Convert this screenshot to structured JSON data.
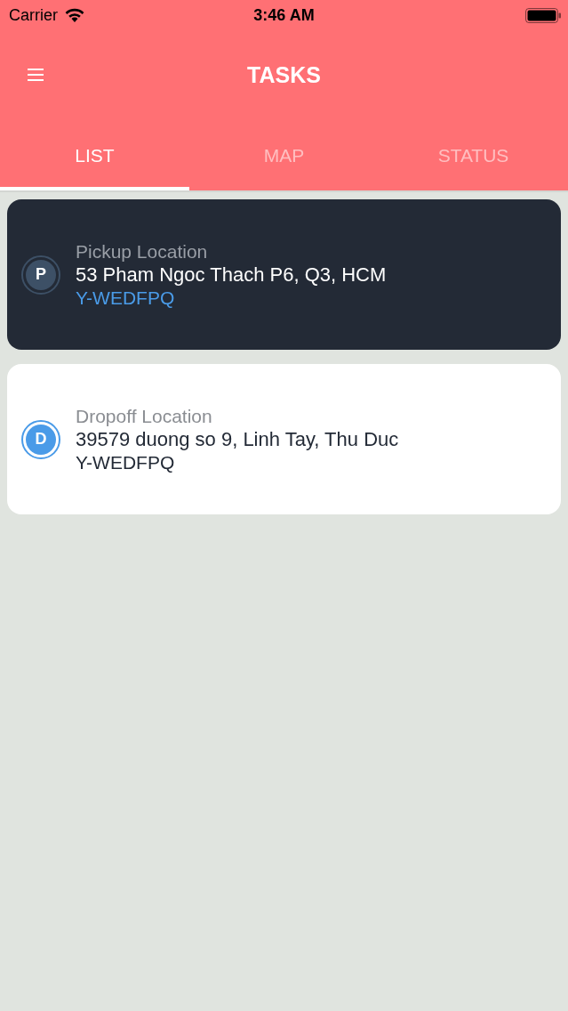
{
  "status_bar": {
    "carrier": "Carrier",
    "time": "3:46 AM"
  },
  "header": {
    "title": "TASKS"
  },
  "tabs": [
    {
      "label": "LIST",
      "selected": true
    },
    {
      "label": "MAP",
      "selected": false
    },
    {
      "label": "STATUS",
      "selected": false
    }
  ],
  "tasks": [
    {
      "selected": true,
      "marker": {
        "letter": "P",
        "color": "#3d5066"
      },
      "label": "Pickup Location",
      "address": "53 Pham Ngoc Thach P6, Q3, HCM",
      "code": "Y-WEDFPQ"
    },
    {
      "selected": false,
      "marker": {
        "letter": "D",
        "color": "#4a9be8"
      },
      "label": "Dropoff Location",
      "address": "39579 duong so 9, Linh Tay, Thu Duc",
      "code": "Y-WEDFPQ"
    }
  ]
}
